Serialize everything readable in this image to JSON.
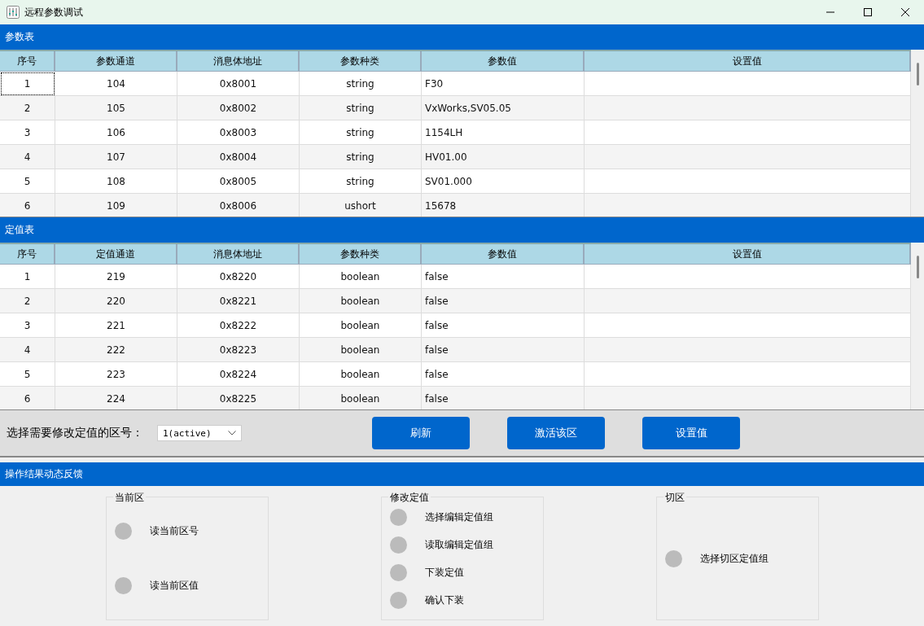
{
  "window": {
    "title": "远程参数调试"
  },
  "tables": [
    {
      "title": "参数表",
      "columns": [
        "序号",
        "参数通道",
        "消息体地址",
        "参数种类",
        "参数值",
        "设置值"
      ],
      "rows": [
        {
          "cells": [
            "1",
            "104",
            "0x8001",
            "string",
            "F30",
            ""
          ],
          "focused": true
        },
        {
          "cells": [
            "2",
            "105",
            "0x8002",
            "string",
            "VxWorks,SV05.05",
            ""
          ],
          "focused": false
        },
        {
          "cells": [
            "3",
            "106",
            "0x8003",
            "string",
            "1154LH",
            ""
          ],
          "focused": false
        },
        {
          "cells": [
            "4",
            "107",
            "0x8004",
            "string",
            "HV01.00",
            ""
          ],
          "focused": false
        },
        {
          "cells": [
            "5",
            "108",
            "0x8005",
            "string",
            "SV01.000",
            ""
          ],
          "focused": false
        },
        {
          "cells": [
            "6",
            "109",
            "0x8006",
            "ushort",
            "15678",
            ""
          ],
          "focused": false
        }
      ]
    },
    {
      "title": "定值表",
      "columns": [
        "序号",
        "定值通道",
        "消息体地址",
        "参数种类",
        "参数值",
        "设置值"
      ],
      "rows": [
        {
          "cells": [
            "1",
            "219",
            "0x8220",
            "boolean",
            "false",
            ""
          ],
          "focused": false
        },
        {
          "cells": [
            "2",
            "220",
            "0x8221",
            "boolean",
            "false",
            ""
          ],
          "focused": false
        },
        {
          "cells": [
            "3",
            "221",
            "0x8222",
            "boolean",
            "false",
            ""
          ],
          "focused": false
        },
        {
          "cells": [
            "4",
            "222",
            "0x8223",
            "boolean",
            "false",
            ""
          ],
          "focused": false
        },
        {
          "cells": [
            "5",
            "223",
            "0x8224",
            "boolean",
            "false",
            ""
          ],
          "focused": false
        },
        {
          "cells": [
            "6",
            "224",
            "0x8225",
            "boolean",
            "false",
            ""
          ],
          "focused": false
        }
      ]
    }
  ],
  "controls": {
    "label": "选择需要修改定值的区号：",
    "zone_select": {
      "value": "1(active)"
    },
    "buttons": [
      "刷新",
      "激活该区",
      "设置值"
    ]
  },
  "feedback": {
    "title": "操作结果动态反馈",
    "groups": [
      {
        "title": "当前区",
        "items": [
          {
            "label": "读当前区号",
            "on": false
          },
          {
            "label": "读当前区值",
            "on": false
          }
        ]
      },
      {
        "title": "修改定值",
        "items": [
          {
            "label": "选择编辑定值组",
            "on": false
          },
          {
            "label": "读取编辑定值组",
            "on": false
          },
          {
            "label": "下装定值",
            "on": false
          },
          {
            "label": "确认下装",
            "on": false
          }
        ]
      },
      {
        "title": "切区",
        "items": [
          {
            "label": "选择切区定值组",
            "on": false
          }
        ]
      }
    ]
  }
}
